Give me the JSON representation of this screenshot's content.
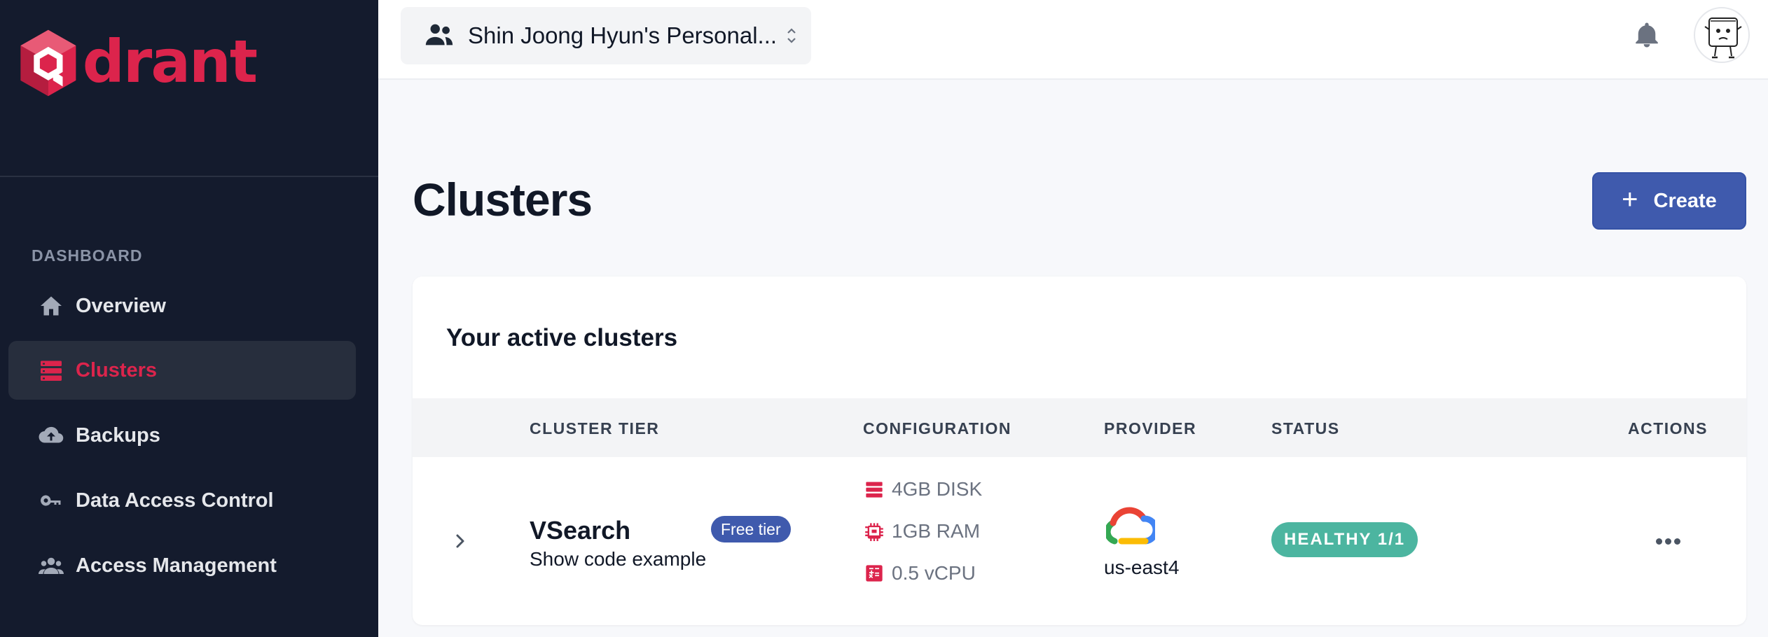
{
  "brand": {
    "logo_text": "drant",
    "accent_color": "#dc244c",
    "primary_color": "#3f5aad"
  },
  "sidebar": {
    "section_label": "DASHBOARD",
    "items": [
      {
        "label": "Overview",
        "icon": "home-icon",
        "active": false
      },
      {
        "label": "Clusters",
        "icon": "server-stack-icon",
        "active": true
      },
      {
        "label": "Backups",
        "icon": "cloud-upload-icon",
        "active": false
      },
      {
        "label": "Data Access Control",
        "icon": "key-icon",
        "active": false
      },
      {
        "label": "Access Management",
        "icon": "users-icon",
        "active": false
      }
    ]
  },
  "topbar": {
    "org_name": "Shin Joong Hyun's Personal...",
    "org_icon": "people-icon",
    "notifications_icon": "bell-icon",
    "avatar_icon": "user-avatar"
  },
  "main": {
    "title": "Clusters",
    "create_button": {
      "icon": "+",
      "label": "Create"
    }
  },
  "clusters_card": {
    "title": "Your active clusters",
    "columns": [
      "CLUSTER TIER",
      "CONFIGURATION",
      "PROVIDER",
      "STATUS",
      "ACTIONS"
    ],
    "rows": [
      {
        "name": "VSearch",
        "tier_badge": "Free tier",
        "code_link": "Show code example",
        "config": [
          {
            "icon": "disk-icon",
            "text": "4GB DISK"
          },
          {
            "icon": "chip-icon",
            "text": "1GB RAM"
          },
          {
            "icon": "calculator-icon",
            "text": "0.5 vCPU"
          }
        ],
        "provider_icon": "google-cloud-icon",
        "region": "us-east4",
        "status": "HEALTHY 1/1",
        "status_color": "#4cb5a0"
      }
    ]
  }
}
